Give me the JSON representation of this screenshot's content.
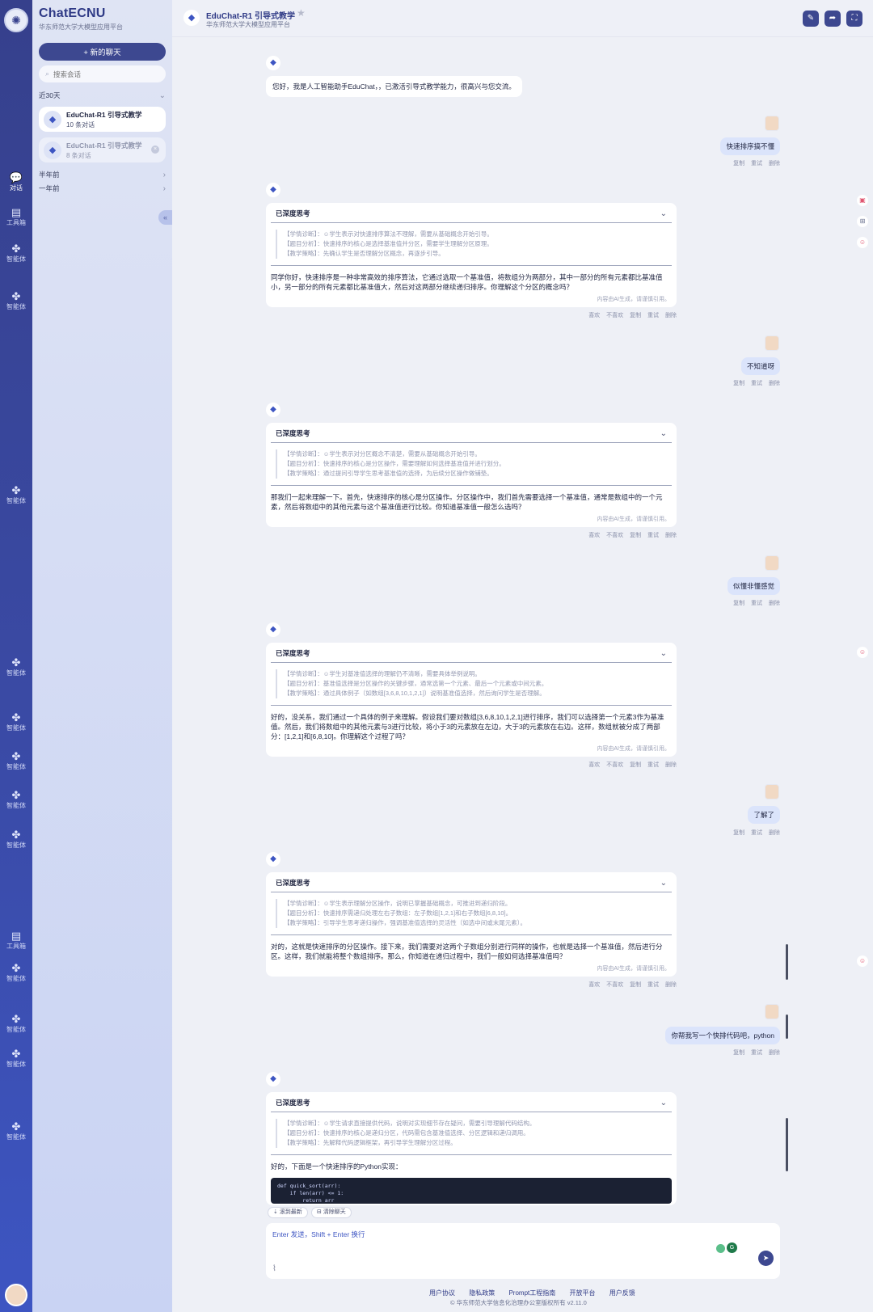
{
  "rail": {
    "items": [
      {
        "label": "对话",
        "icon": "chat-icon"
      },
      {
        "label": "工具箱",
        "icon": "toolbox-icon"
      },
      {
        "label": "智能体",
        "icon": "agent-icon"
      },
      {
        "label": "智能体",
        "icon": "agent-icon"
      },
      {
        "label": "智能体",
        "icon": "agent-icon"
      },
      {
        "label": "智能体",
        "icon": "agent-icon"
      },
      {
        "label": "智能体",
        "icon": "agent-icon"
      },
      {
        "label": "智能体",
        "icon": "agent-icon"
      },
      {
        "label": "智能体",
        "icon": "agent-icon"
      },
      {
        "label": "智能体",
        "icon": "agent-icon"
      },
      {
        "label": "工具箱",
        "icon": "toolbox-icon"
      },
      {
        "label": "智能体",
        "icon": "agent-icon"
      },
      {
        "label": "智能体",
        "icon": "agent-icon"
      },
      {
        "label": "智能体",
        "icon": "agent-icon"
      },
      {
        "label": "智能体",
        "icon": "agent-icon"
      }
    ]
  },
  "sidebar": {
    "brand_title": "ChatECNU",
    "brand_subtitle": "华东师范大学大模型应用平台",
    "new_chat_label": "+ 新的聊天",
    "search_placeholder": "搜索会话",
    "group_recent": "近30天",
    "group_half_year": "半年前",
    "group_year": "一年前",
    "conversations": [
      {
        "title": "EduChat-R1 引导式教学",
        "count": "10 条对话"
      },
      {
        "title": "EduChat-R1 引导式教学",
        "count": "8 条对话"
      }
    ]
  },
  "header": {
    "title": "EduChat-R1 引导式教学",
    "subtitle": "华东师范大学大模型应用平台"
  },
  "labels": {
    "deep_thinking": "已深度思考",
    "ai_note": "内容由AI生成，请谨慎引用。",
    "action_like": "喜欢",
    "action_dislike": "不喜欢",
    "action_copy": "复制",
    "action_retry": "重试",
    "action_delete": "删除"
  },
  "chat": {
    "greeting": "您好，我是人工智能助手EduChat，，已激活引导式教学能力，很高兴与您交流。",
    "user_messages": [
      "快速排序搞不懂",
      "不知道呀",
      "似懂非懂感觉",
      "了解了",
      "你帮我写一个快排代码吧，python"
    ],
    "bot_cards": [
      {
        "thinking": [
          "【学情诊断】：☺学生表示对快速排序算法不理解，需要从基础概念开始引导。",
          "【题目分析】：快速排序的核心是选择基准值并分区，需要学生理解分区原理。",
          "【教学策略】：先确认学生是否理解分区概念，再逐步引导。"
        ],
        "answer": "同学你好，快速排序是一种非常高效的排序算法，它通过选取一个基准值，将数组分为两部分，其中一部分的所有元素都比基准值小，另一部分的所有元素都比基准值大，然后对这两部分继续递归排序。你理解这个分区的概念吗？"
      },
      {
        "thinking": [
          "【学情诊断】：☺学生表示对分区概念不清楚，需要从基础概念开始引导。",
          "【题目分析】：快速排序的核心是分区操作，需要理解如何选择基准值并进行划分。",
          "【教学策略】：通过提问引导学生思考基准值的选择，为后续分区操作做铺垫。"
        ],
        "answer": "那我们一起来理解一下。首先，快速排序的核心是分区操作。分区操作中，我们首先需要选择一个基准值，通常是数组中的一个元素，然后将数组中的其他元素与这个基准值进行比较。你知道基准值一般怎么选吗？"
      },
      {
        "thinking": [
          "【学情诊断】：☺学生对基准值选择的理解仍不清晰，需要具体举例说明。",
          "【题目分析】：基准值选择是分区操作的关键步骤，通常选第一个元素、最后一个元素或中间元素。",
          "【教学策略】：通过具体例子（如数组[3,6,8,10,1,2,1]）说明基准值选择，然后询问学生是否理解。"
        ],
        "answer": "好的，没关系，我们通过一个具体的例子来理解。假设我们要对数组[3,6,8,10,1,2,1]进行排序，我们可以选择第一个元素3作为基准值。然后，我们将数组中的其他元素与3进行比较，将小于3的元素放在左边，大于3的元素放在右边。这样，数组就被分成了两部分：[1,2,1]和[6,8,10]。你理解这个过程了吗？"
      },
      {
        "thinking": [
          "【学情诊断】：☺学生表示理解分区操作，说明已掌握基础概念，可推进到递归阶段。",
          "【题目分析】：快速排序需递归处理左右子数组：左子数组[1,2,1]和右子数组[6,8,10]。",
          "【教学策略】：引导学生思考递归操作，强调基准值选择的灵活性（如选中间或末尾元素）。"
        ],
        "answer": "对的，这就是快速排序的分区操作。接下来，我们需要对这两个子数组分别进行同样的操作，也就是选择一个基准值，然后进行分区。这样，我们就能将整个数组排序。那么，你知道在递归过程中，我们一般如何选择基准值吗？"
      },
      {
        "thinking": [
          "【学情诊断】：☺学生请求直接提供代码，说明对实现细节存在疑问，需要引导理解代码结构。",
          "【题目分析】：快速排序的核心是递归分区，代码需包含基准值选择、分区逻辑和递归调用。",
          "【教学策略】：先解释代码逻辑框架，再引导学生理解分区过程。"
        ],
        "answer": "好的，下面是一个快速排序的Python实现：",
        "code": [
          "def quick_sort(arr):",
          "    if len(arr) <= 1:",
          "        return arr"
        ]
      }
    ]
  },
  "bottom": {
    "scroll_latest": "滚到最新",
    "clear_chat": "清除聊天",
    "input_placeholder": "Enter 发送，Shift + Enter 换行"
  },
  "footer": {
    "links": [
      "用户协议",
      "隐私政策",
      "Prompt工程指南",
      "开放平台",
      "用户反馈"
    ],
    "copyright": "© 华东师范大学信息化治理办公室版权所有 v2.11.0"
  }
}
